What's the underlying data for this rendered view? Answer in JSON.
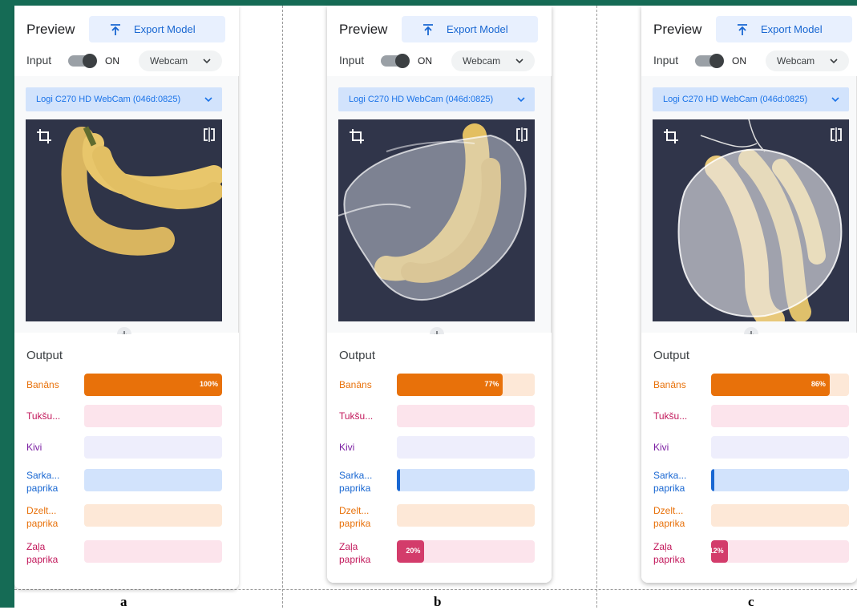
{
  "panels": [
    {
      "id": "a",
      "preview_title": "Preview",
      "export_label": "Export Model",
      "input_label": "Input",
      "toggle_label": "ON",
      "source_label": "Webcam",
      "device_label": "Logi C270 HD WebCam (046d:0825)",
      "output_title": "Output",
      "caption": "a",
      "classes": [
        {
          "label": "Banāns",
          "value": 100,
          "value_label": "100%"
        },
        {
          "label": "Tukšu...",
          "value": 0,
          "value_label": ""
        },
        {
          "label": "Kivi",
          "value": 0,
          "value_label": ""
        },
        {
          "label": "Sarka...\npaprika",
          "value": 0,
          "value_label": ""
        },
        {
          "label": "Dzelt...\npaprika",
          "value": 0,
          "value_label": ""
        },
        {
          "label": "Zaļa\npaprika",
          "value": 0,
          "value_label": ""
        }
      ]
    },
    {
      "id": "b",
      "preview_title": "Preview",
      "export_label": "Export Model",
      "input_label": "Input",
      "toggle_label": "ON",
      "source_label": "Webcam",
      "device_label": "Logi C270 HD WebCam (046d:0825)",
      "output_title": "Output",
      "caption": "b",
      "classes": [
        {
          "label": "Banāns",
          "value": 77,
          "value_label": "77%"
        },
        {
          "label": "Tukšu...",
          "value": 0,
          "value_label": ""
        },
        {
          "label": "Kivi",
          "value": 0,
          "value_label": ""
        },
        {
          "label": "Sarka...\npaprika",
          "value": 2,
          "value_label": ""
        },
        {
          "label": "Dzelt...\npaprika",
          "value": 0,
          "value_label": ""
        },
        {
          "label": "Zaļa\npaprika",
          "value": 20,
          "value_label": "20%"
        }
      ]
    },
    {
      "id": "c",
      "preview_title": "Preview",
      "export_label": "Export Model",
      "input_label": "Input",
      "toggle_label": "ON",
      "source_label": "Webcam",
      "device_label": "Logi C270 HD WebCam (046d:0825)",
      "output_title": "Output",
      "caption": "c",
      "classes": [
        {
          "label": "Banāns",
          "value": 86,
          "value_label": "86%"
        },
        {
          "label": "Tukšu...",
          "value": 0,
          "value_label": ""
        },
        {
          "label": "Kivi",
          "value": 0,
          "value_label": ""
        },
        {
          "label": "Sarka...\npaprika",
          "value": 1,
          "value_label": ""
        },
        {
          "label": "Dzelt...\npaprika",
          "value": 0,
          "value_label": ""
        },
        {
          "label": "Zaļa\npaprika",
          "value": 12,
          "value_label": "12%"
        }
      ]
    }
  ],
  "class_colors": [
    {
      "text": "#e8710a",
      "fill": "#e8710a",
      "track": "#fde8d7"
    },
    {
      "text": "#c2185b",
      "fill": "#d81b60",
      "track": "#fce4ec"
    },
    {
      "text": "#7b1fa2",
      "fill": "#8e24aa",
      "track": "#eeeefc"
    },
    {
      "text": "#1967d2",
      "fill": "#1967d2",
      "track": "#d2e3fc"
    },
    {
      "text": "#e8710a",
      "fill": "#e8710a",
      "track": "#fde8d7"
    },
    {
      "text": "#c2185b",
      "fill": "#d33c6b",
      "track": "#fce4ec"
    }
  ],
  "icons": {
    "export": "upload-icon",
    "chevron": "chevron-down-icon",
    "crop": "crop-icon",
    "flip": "flip-camera-icon",
    "arrow": "arrow-down-icon"
  }
}
